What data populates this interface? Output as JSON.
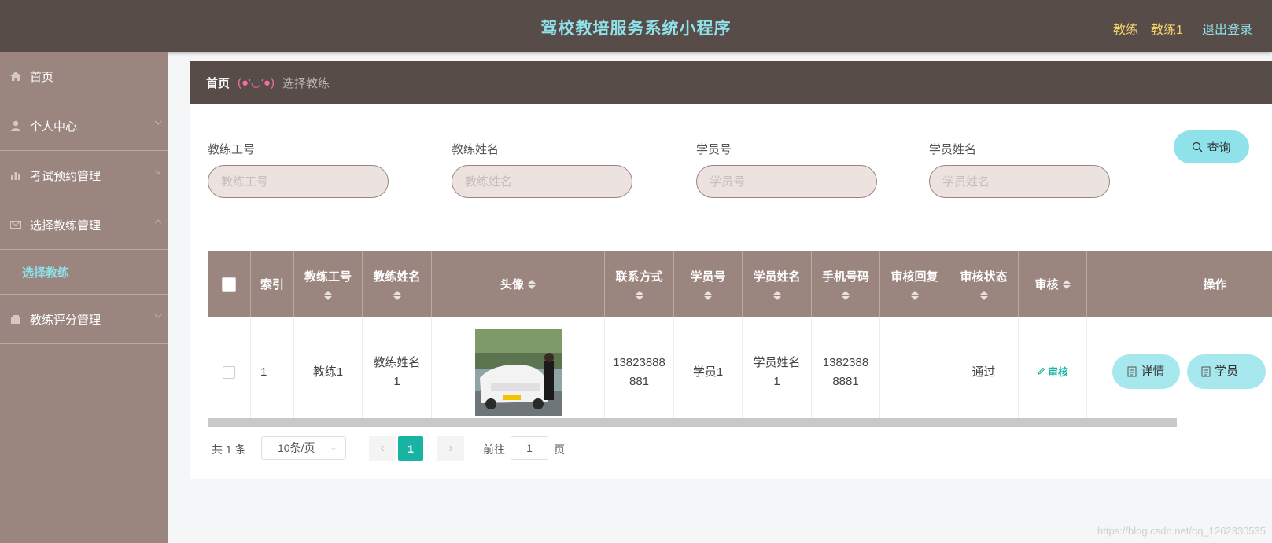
{
  "header": {
    "title": "驾校教培服务系统小程序",
    "user_role": "教练",
    "user_name": "教练1",
    "logout_label": "退出登录"
  },
  "sidebar": {
    "items": [
      {
        "label": "首页",
        "icon": "home-icon"
      },
      {
        "label": "个人中心",
        "icon": "user-icon"
      },
      {
        "label": "考试预约管理",
        "icon": "chart-icon"
      },
      {
        "label": "选择教练管理",
        "icon": "mail-icon"
      },
      {
        "label": "教练评分管理",
        "icon": "cart-icon"
      }
    ],
    "submenu_active": "选择教练"
  },
  "breadcrumb": {
    "home": "首页",
    "face": "(●'◡'●)",
    "current": "选择教练"
  },
  "search": {
    "fields": [
      {
        "label": "教练工号",
        "placeholder": "教练工号"
      },
      {
        "label": "教练姓名",
        "placeholder": "教练姓名"
      },
      {
        "label": "学员号",
        "placeholder": "学员号"
      },
      {
        "label": "学员姓名",
        "placeholder": "学员姓名"
      }
    ],
    "query_label": "查询"
  },
  "table": {
    "headers": {
      "index": "索引",
      "coach_id": "教练工号",
      "coach_name": "教练姓名",
      "avatar": "头像",
      "contact": "联系方式",
      "student_id": "学员号",
      "student_name": "学员姓名",
      "phone": "手机号码",
      "audit_reply": "审核回复",
      "audit_status": "审核状态",
      "audit": "审核",
      "operation": "操作"
    },
    "rows": [
      {
        "index": "1",
        "coach_id": "教练1",
        "coach_name": "教练姓名1",
        "contact": "13823888881",
        "student_id": "学员1",
        "student_name": "学员姓名1",
        "phone": "13823888881",
        "audit_reply": "",
        "audit_status": "通过",
        "audit_link": "审核",
        "detail_label": "详情",
        "student_label": "学员"
      }
    ]
  },
  "pagination": {
    "total_text": "共 1 条",
    "page_size": "10条/页",
    "current_page": "1",
    "goto_label": "前往",
    "goto_value": "1",
    "page_unit": "页"
  },
  "watermark": "https://blog.csdn.net/qq_1262330535",
  "colors": {
    "header_bg": "#574c48",
    "sidebar_bg": "#9b857f",
    "accent_cyan": "#8fe1ea",
    "accent_yellow": "#f2d36b",
    "active_page": "#19b3a3"
  }
}
